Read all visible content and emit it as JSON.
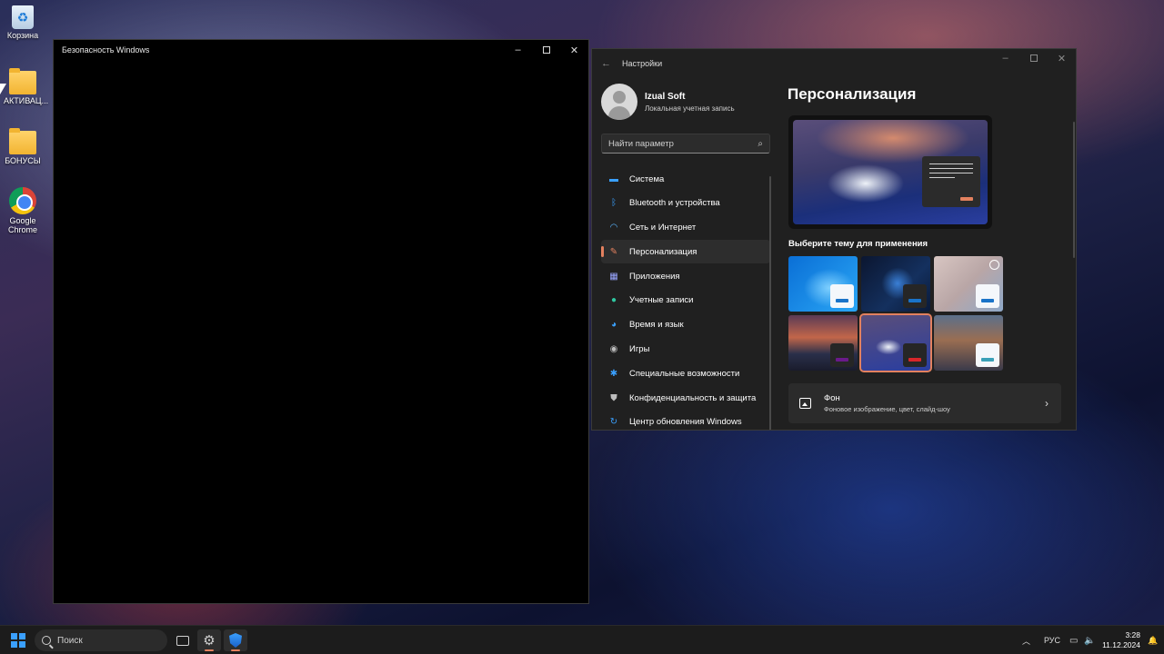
{
  "desktop": {
    "icons": [
      {
        "label": "Корзина"
      },
      {
        "label": "АКТИВАЦ..."
      },
      {
        "label": "БОНУСЫ"
      },
      {
        "label": "Google Chrome"
      }
    ]
  },
  "security_window": {
    "title": "Безопасность Windows",
    "controls": {
      "minimize": "–",
      "close": "✕"
    }
  },
  "settings_window": {
    "title": "Настройки",
    "back": "←",
    "controls": {
      "minimize": "–",
      "close": "✕"
    },
    "user": {
      "name": "Izual Soft",
      "account": "Локальная учетная запись"
    },
    "search_placeholder": "Найти параметр",
    "nav": [
      {
        "label": "Система",
        "icon": "monitor-icon",
        "color": "#3aa0ff"
      },
      {
        "label": "Bluetooth и устройства",
        "icon": "bluetooth-icon",
        "color": "#3aa0ff"
      },
      {
        "label": "Сеть и Интернет",
        "icon": "wifi-icon",
        "color": "#5ab6ff"
      },
      {
        "label": "Персонализация",
        "icon": "brush-icon",
        "color": "#e3815f"
      },
      {
        "label": "Приложения",
        "icon": "apps-icon",
        "color": "#9aa6ff"
      },
      {
        "label": "Учетные записи",
        "icon": "person-icon",
        "color": "#2fc7a0"
      },
      {
        "label": "Время и язык",
        "icon": "globe-icon",
        "color": "#3aa0ff"
      },
      {
        "label": "Игры",
        "icon": "gamepad-icon",
        "color": "#bdbdbd"
      },
      {
        "label": "Специальные возможности",
        "icon": "accessibility-icon",
        "color": "#3aa0ff"
      },
      {
        "label": "Конфиденциальность и защита",
        "icon": "shield-icon",
        "color": "#bdbdbd"
      },
      {
        "label": "Центр обновления Windows",
        "icon": "update-icon",
        "color": "#3aa0ff"
      }
    ],
    "active_nav": "Персонализация",
    "page_title": "Персонализация",
    "theme_section_label": "Выберите тему для применения",
    "background_card": {
      "title": "Фон",
      "subtitle": "Фоновое изображение, цвет, слайд-шоу"
    }
  },
  "taskbar": {
    "search_label": "Поиск",
    "language": "РУС",
    "time": "3:28",
    "date": "11.12.2024"
  },
  "colors": {
    "accent": "#e3815f",
    "windows_blue": "#3aa0ff"
  }
}
